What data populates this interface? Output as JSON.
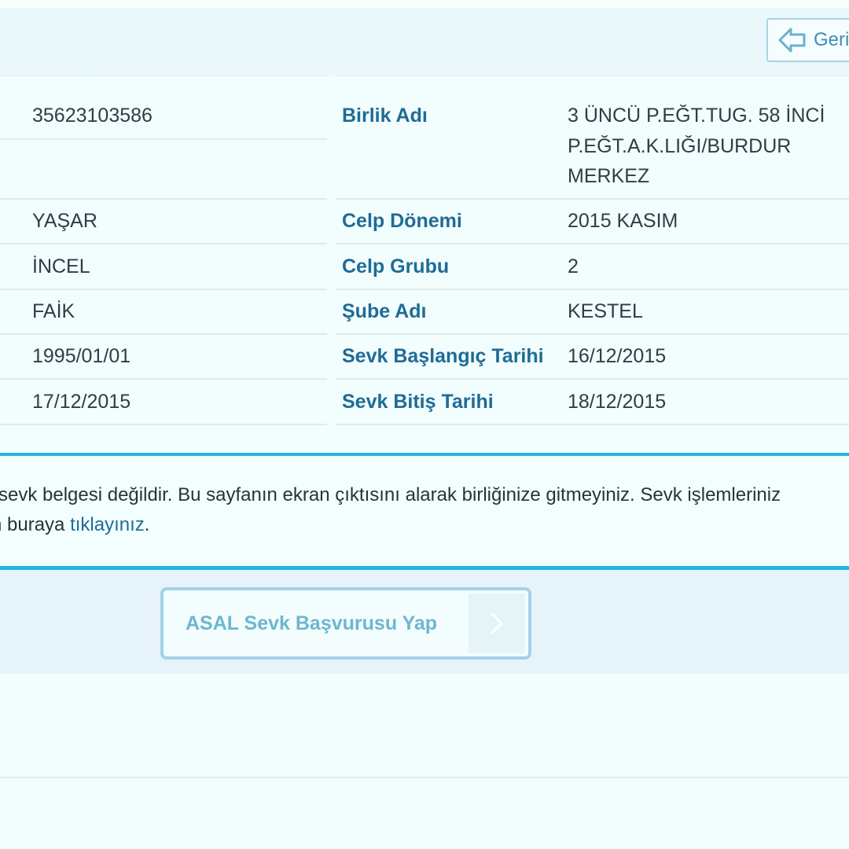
{
  "header": {
    "back_label": "Geri"
  },
  "details": {
    "left_values": [
      "35623103586",
      "YAŞAR",
      "İNCEL",
      "FAİK",
      "1995/01/01",
      "17/12/2015"
    ],
    "right": [
      {
        "label": "Birlik Adı",
        "value_lines": [
          "3 ÜNCÜ P.EĞT.TUG. 58 İNCİ",
          "P.EĞT.A.K.LIĞI/BURDUR",
          "MERKEZ"
        ]
      },
      {
        "label": "Celp Dönemi",
        "value": "2015 KASIM"
      },
      {
        "label": "Celp Grubu",
        "value": "2"
      },
      {
        "label": "Şube Adı",
        "value": "KESTEL"
      },
      {
        "label": "Sevk Başlangıç Tarihi",
        "value": "16/12/2015"
      },
      {
        "label": "Sevk Bitiş Tarihi",
        "value": "18/12/2015"
      }
    ]
  },
  "notice": {
    "line1": "sevk belgesi değildir. Bu sayfanın ekran çıktısını alarak birliğinize gitmeyiniz. Sevk işlemleriniz",
    "line2_prefix": "n buraya ",
    "link_text": "tıklayınız",
    "line2_suffix": "."
  },
  "action": {
    "apply_label": "ASAL Sevk Başvurusu Yap"
  }
}
